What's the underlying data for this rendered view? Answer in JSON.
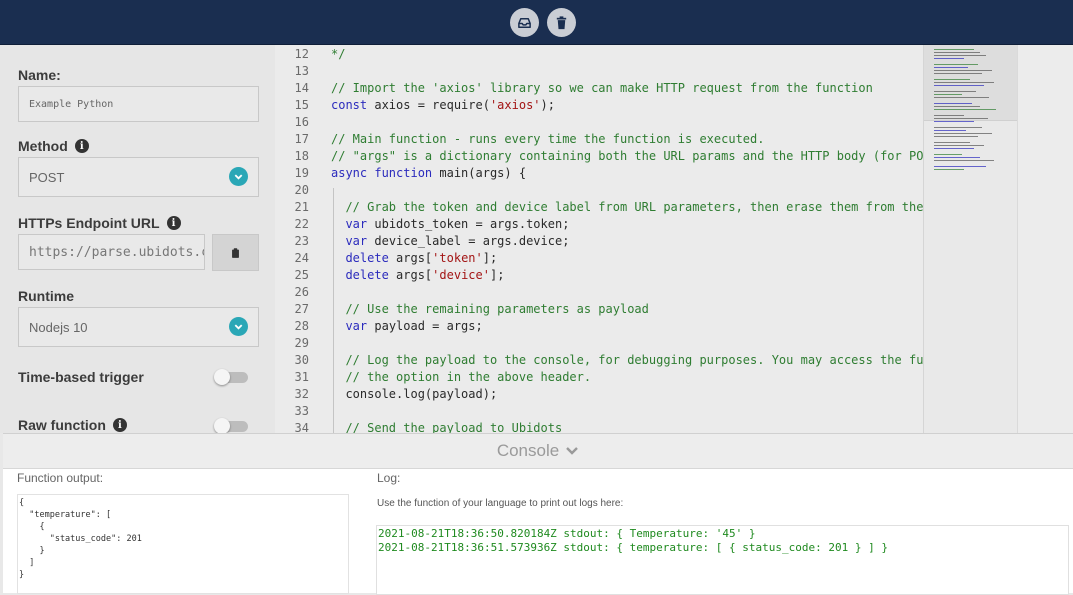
{
  "topbar": {
    "buttons": [
      {
        "icon": "inbox-icon"
      },
      {
        "icon": "trash-icon"
      }
    ]
  },
  "sidebar": {
    "name_label": "Name:",
    "name_value": "Example Python",
    "method_label": "Method",
    "method_value": "POST",
    "endpoint_label": "HTTPs Endpoint URL",
    "endpoint_value": "https://parse.ubidots.c",
    "runtime_label": "Runtime",
    "runtime_value": "Nodejs 10",
    "time_trigger_label": "Time-based trigger",
    "time_trigger_on": false,
    "raw_function_label": "Raw function",
    "raw_function_on": false
  },
  "editor": {
    "lines": [
      {
        "n": "12",
        "parts": [
          {
            "t": "*/",
            "c": "comment"
          }
        ]
      },
      {
        "n": "13",
        "parts": []
      },
      {
        "n": "14",
        "parts": [
          {
            "t": "// Import the 'axios' library so we can make HTTP request from the function",
            "c": "comment"
          }
        ]
      },
      {
        "n": "15",
        "parts": [
          {
            "t": "const",
            "c": "kw"
          },
          {
            "t": " axios = require(",
            "c": ""
          },
          {
            "t": "'axios'",
            "c": "str"
          },
          {
            "t": ");",
            "c": ""
          }
        ]
      },
      {
        "n": "16",
        "parts": []
      },
      {
        "n": "17",
        "parts": [
          {
            "t": "// Main function - runs every time the function is executed.",
            "c": "comment"
          }
        ]
      },
      {
        "n": "18",
        "parts": [
          {
            "t": "// \"args\" is a dictionary containing both the URL params and the HTTP body (for POST r",
            "c": "comment"
          }
        ]
      },
      {
        "n": "19",
        "parts": [
          {
            "t": "async",
            "c": "kw"
          },
          {
            "t": " ",
            "c": ""
          },
          {
            "t": "function",
            "c": "kw"
          },
          {
            "t": " main(args) {",
            "c": ""
          }
        ]
      },
      {
        "n": "20",
        "parts": []
      },
      {
        "n": "21",
        "parts": [
          {
            "t": "  // Grab the token and device label from URL parameters, then erase them from the arg",
            "c": "comment"
          }
        ]
      },
      {
        "n": "22",
        "parts": [
          {
            "t": "  ",
            "c": ""
          },
          {
            "t": "var",
            "c": "kw"
          },
          {
            "t": " ubidots_token = args.token;",
            "c": ""
          }
        ]
      },
      {
        "n": "23",
        "parts": [
          {
            "t": "  ",
            "c": ""
          },
          {
            "t": "var",
            "c": "kw"
          },
          {
            "t": " device_label = args.device;",
            "c": ""
          }
        ]
      },
      {
        "n": "24",
        "parts": [
          {
            "t": "  ",
            "c": ""
          },
          {
            "t": "delete",
            "c": "kw"
          },
          {
            "t": " args[",
            "c": ""
          },
          {
            "t": "'token'",
            "c": "str"
          },
          {
            "t": "];",
            "c": ""
          }
        ]
      },
      {
        "n": "25",
        "parts": [
          {
            "t": "  ",
            "c": ""
          },
          {
            "t": "delete",
            "c": "kw"
          },
          {
            "t": " args[",
            "c": ""
          },
          {
            "t": "'device'",
            "c": "str"
          },
          {
            "t": "];",
            "c": ""
          }
        ]
      },
      {
        "n": "26",
        "parts": []
      },
      {
        "n": "27",
        "parts": [
          {
            "t": "  // Use the remaining parameters as payload",
            "c": "comment"
          }
        ]
      },
      {
        "n": "28",
        "parts": [
          {
            "t": "  ",
            "c": ""
          },
          {
            "t": "var",
            "c": "kw"
          },
          {
            "t": " payload = args;",
            "c": ""
          }
        ]
      },
      {
        "n": "29",
        "parts": []
      },
      {
        "n": "30",
        "parts": [
          {
            "t": "  // Log the payload to the console, for debugging purposes. You may access the functi",
            "c": "comment"
          }
        ]
      },
      {
        "n": "31",
        "parts": [
          {
            "t": "  // the option in the above header.",
            "c": "comment"
          }
        ]
      },
      {
        "n": "32",
        "parts": [
          {
            "t": "  console.log(payload);",
            "c": ""
          }
        ]
      },
      {
        "n": "33",
        "parts": []
      },
      {
        "n": "34",
        "parts": [
          {
            "t": "  // Send the payload to Ubidots",
            "c": "comment"
          }
        ]
      }
    ]
  },
  "console": {
    "title": "Console",
    "output_label": "Function output:",
    "output_lines": [
      "{",
      "  \"temperature\": [",
      "    {",
      "      \"status_code\": 201",
      "    }",
      "  ]",
      "}"
    ],
    "log_label": "Log:",
    "log_hint": "Use the function of your language to print out logs here:",
    "log_lines": [
      "2021-08-21T18:36:50.820184Z stdout: { Temperature: '45' }",
      "2021-08-21T18:36:51.573936Z stdout: { temperature: [ { status_code: 201 } ] }"
    ]
  },
  "colors": {
    "topbar": "#1a2e50",
    "accent": "#2aa7b6",
    "comment": "#2f7d32",
    "keyword": "#2b2bbd",
    "string": "#a31515",
    "log_text": "#1f8a1f"
  }
}
